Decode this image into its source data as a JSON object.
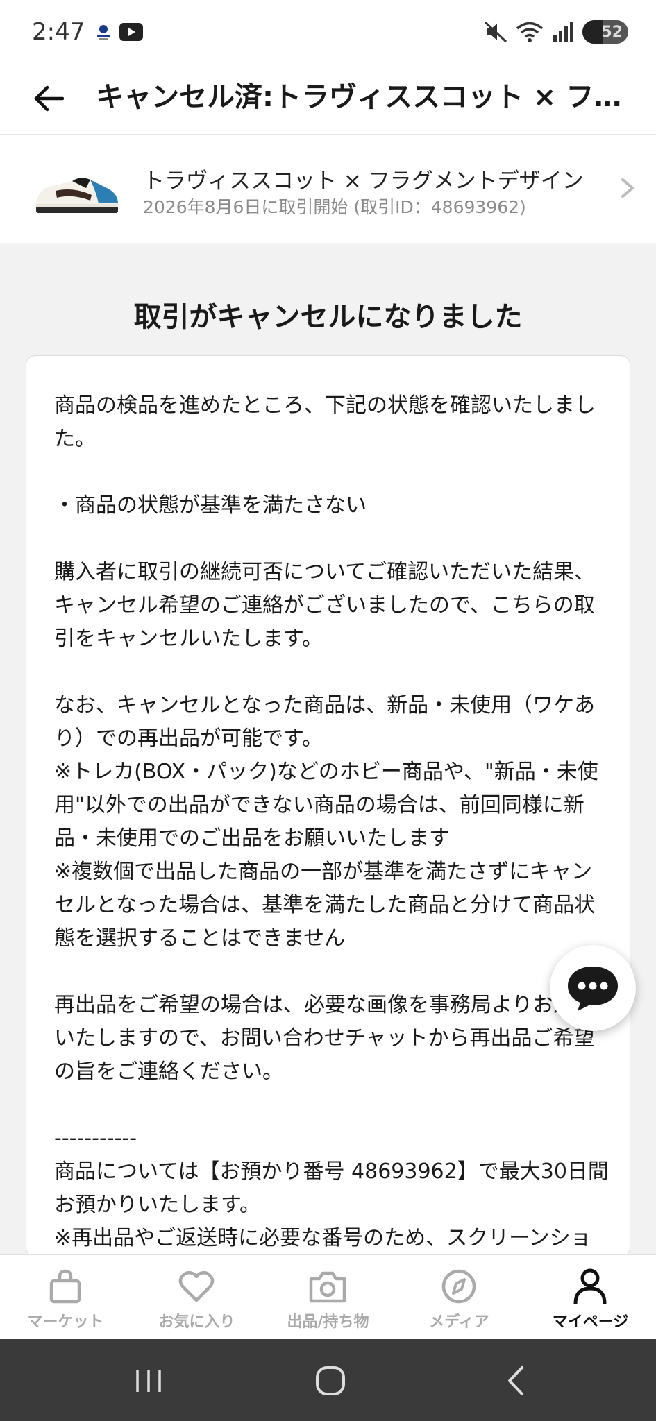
{
  "status_bar": {
    "time": "2:47",
    "battery": "52"
  },
  "header": {
    "title": "キャンセル済:トラヴィススコット × フラグメントデザイン"
  },
  "product": {
    "name": "トラヴィススコット × フラグメントデザイン",
    "subtitle": "2026年8月6日に取引開始 (取引ID：48693962)"
  },
  "main": {
    "cancel_title": "取引がキャンセルになりました",
    "message": "商品の検品を進めたところ、下記の状態を確認いたしました。\n\n・商品の状態が基準を満たさない\n\n購入者に取引の継続可否についてご確認いただいた結果、キャンセル希望のご連絡がございましたので、こちらの取引をキャンセルいたします。\n\nなお、キャンセルとなった商品は、新品・未使用（ワケあり）での再出品が可能です。\n※トレカ(BOX・パック)などのホビー商品や、\"新品・未使用\"以外での出品ができない商品の場合は、前回同様に新品・未使用でのご出品をお願いいたします\n※複数個で出品した商品の一部が基準を満たさずにキャンセルとなった場合は、基準を満たした商品と分けて商品状態を選択することはできません\n\n再出品をご希望の場合は、必要な画像を事務局よりお送りいたしますので、お問い合わせチャットから再出品ご希望の旨をご連絡ください。\n\n-----------\n商品については【お預かり番号 48693962】で最大30日間お預かりいたします。\n※再出品やご返送時に必要な番号のため、スクリーンショットを保存してください"
  },
  "bottom_nav": [
    {
      "label": "マーケット",
      "icon": "bag-icon"
    },
    {
      "label": "お気に入り",
      "icon": "heart-icon"
    },
    {
      "label": "出品/持ち物",
      "icon": "camera-icon"
    },
    {
      "label": "メディア",
      "icon": "compass-icon"
    },
    {
      "label": "マイページ",
      "icon": "person-icon",
      "active": true
    }
  ],
  "colors": {
    "background": "#f2f2f2",
    "nav_inactive": "#aaaaaa",
    "nav_active": "#111111",
    "system_nav": "#3a3a3a"
  }
}
